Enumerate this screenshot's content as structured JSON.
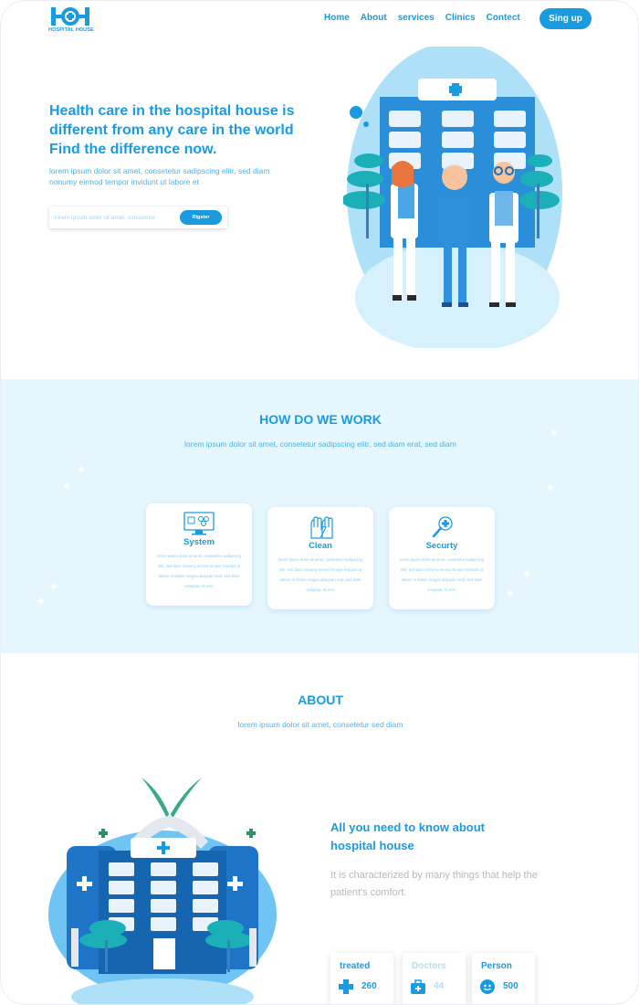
{
  "brand": {
    "logo_text": "HOSPITAL HOUSE"
  },
  "nav": {
    "items": [
      "Home",
      "About",
      "services",
      "Clinics",
      "Contect"
    ],
    "signup_label": "Sing up"
  },
  "hero": {
    "title": "Health care in the hospital house is different from any care in the world Find the difference now.",
    "subtitle": "lorem ipsum dolor sit amet, consetetur sadipscing elitr, sed diam nonumy eirmod tempor invidunt ut labore et",
    "input_placeholder": "lorem ipsum dolor sit amet, consetetur",
    "button_label": "Rigster"
  },
  "how": {
    "title": "HOW DO WE WORK",
    "subtitle": "lorem ipsum dolor sit amet, consetetur sadipscing elitr, sed diam  erat, sed diam",
    "cards": [
      {
        "title": "System",
        "icon": "monitor-icon",
        "text": "lorem ipsum dolor sit amet, consetetur sadipscing elitr, sed diam nonumy eirmod tempor invidunt ut labore et dolore magna aliquyam erat, sed diam voluptua. At vero"
      },
      {
        "title": "Clean",
        "icon": "gloves-icon",
        "text": "lorem ipsum dolor sit amet, consetetur sadipscing elitr, sed diam nonumy eirmod tempor invidunt ut labore et dolore magna aliquyam erat, sed diam voluptua. At vero"
      },
      {
        "title": "Securty",
        "icon": "magnifier-icon",
        "text": "lorem ipsum dolor sit amet, consetetur sadipscing elitr, sed diam nonumy eirmod tempor invidunt ut labore et dolore magna aliquyam erat, sed diam voluptua. At vero"
      }
    ]
  },
  "about": {
    "title": "ABOUT",
    "subtitle": "lorem ipsum dolor sit amet, consetetur sed diam",
    "heading": "All you need to know about hospital house",
    "text": "It is characterized by many things that help the patient's comfort.",
    "stats": [
      {
        "label": "treated",
        "value": "260",
        "icon": "medical-cross-icon"
      },
      {
        "label": "Doctors",
        "value": "44",
        "icon": "first-aid-kit-icon"
      },
      {
        "label": "Person",
        "value": "500",
        "icon": "person-face-icon"
      }
    ]
  },
  "colors": {
    "primary": "#1a9be0",
    "light_bg": "#e6f6fd",
    "muted_text": "#b5b8bd",
    "dark_blue": "#1565b0"
  }
}
